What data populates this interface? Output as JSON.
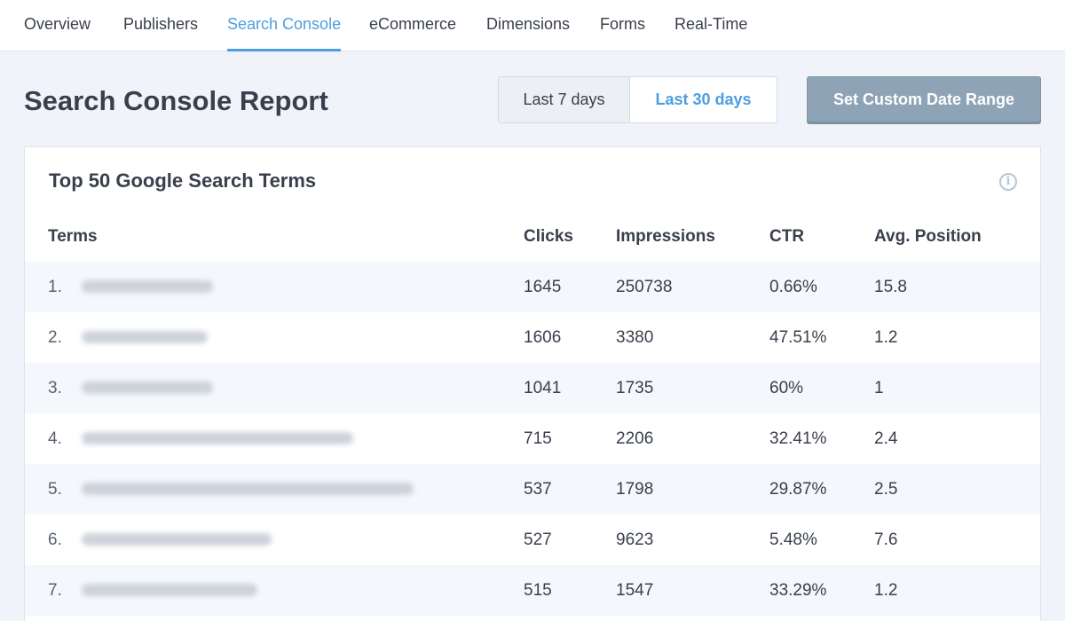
{
  "nav": {
    "tabs": [
      {
        "label": "Overview",
        "active": false
      },
      {
        "label": "Publishers",
        "active": false
      },
      {
        "label": "Search Console",
        "active": true
      },
      {
        "label": "eCommerce",
        "active": false
      },
      {
        "label": "Dimensions",
        "active": false
      },
      {
        "label": "Forms",
        "active": false
      },
      {
        "label": "Real-Time",
        "active": false
      }
    ]
  },
  "header": {
    "title": "Search Console Report",
    "range_7": "Last 7 days",
    "range_30": "Last 30 days",
    "selected_range": "Last 30 days",
    "custom_range": "Set Custom Date Range"
  },
  "panel": {
    "title": "Top 50 Google Search Terms",
    "info_icon": "info-icon",
    "columns": {
      "terms": "Terms",
      "clicks": "Clicks",
      "impressions": "Impressions",
      "ctr": "CTR",
      "position": "Avg. Position"
    },
    "rows": [
      {
        "index": "1.",
        "clicks": "1645",
        "impressions": "250738",
        "ctr": "0.66%",
        "position": "15.8"
      },
      {
        "index": "2.",
        "clicks": "1606",
        "impressions": "3380",
        "ctr": "47.51%",
        "position": "1.2"
      },
      {
        "index": "3.",
        "clicks": "1041",
        "impressions": "1735",
        "ctr": "60%",
        "position": "1"
      },
      {
        "index": "4.",
        "clicks": "715",
        "impressions": "2206",
        "ctr": "32.41%",
        "position": "2.4"
      },
      {
        "index": "5.",
        "clicks": "537",
        "impressions": "1798",
        "ctr": "29.87%",
        "position": "2.5"
      },
      {
        "index": "6.",
        "clicks": "527",
        "impressions": "9623",
        "ctr": "5.48%",
        "position": "7.6"
      },
      {
        "index": "7.",
        "clicks": "515",
        "impressions": "1547",
        "ctr": "33.29%",
        "position": "1.2"
      }
    ]
  },
  "colors": {
    "accent": "#4e9de0",
    "text": "#393f4c",
    "background": "#f0f4fa",
    "custom_button": "#8ea4b6"
  }
}
